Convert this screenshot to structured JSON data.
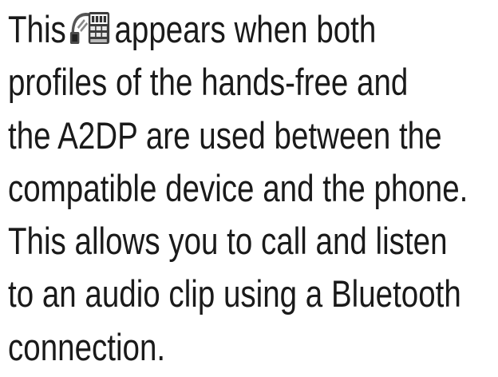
{
  "paragraph": {
    "line1_before_icon": "This",
    "line1_after_icon": "appears when both",
    "lines": [
      "profiles of the hands-free and",
      "the A2DP are used between the",
      "compatible device and the phone.",
      "This allows you to call and listen",
      "to an audio clip using a Bluetooth",
      "connection."
    ],
    "icon": "bluetooth-headset-a2dp-icon"
  }
}
